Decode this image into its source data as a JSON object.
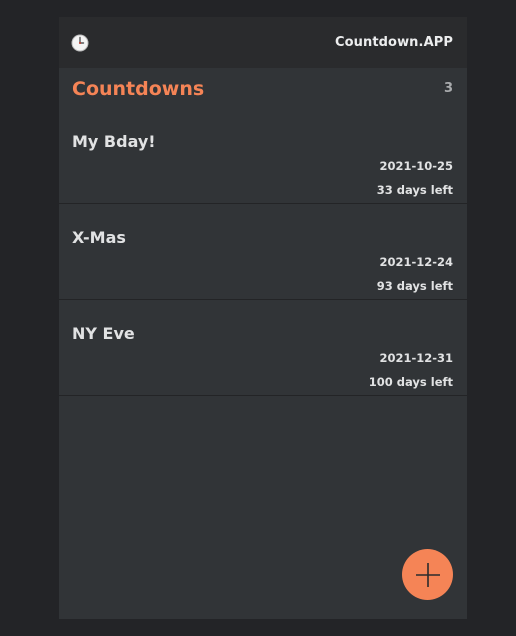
{
  "topbar": {
    "clock_icon": "clock-icon",
    "app_title": "Countdown.APP"
  },
  "header": {
    "title": "Countdowns",
    "count": "3"
  },
  "countdowns": [
    {
      "name": "My Bday!",
      "date": "2021-10-25",
      "days_left": "33 days left"
    },
    {
      "name": "X-Mas",
      "date": "2021-12-24",
      "days_left": "93 days left"
    },
    {
      "name": "NY Eve",
      "date": "2021-12-31",
      "days_left": "100 days left"
    }
  ],
  "fab": {
    "icon": "plus-icon"
  },
  "colors": {
    "accent": "#f58456",
    "background": "#232427",
    "panel": "#313437",
    "topbar": "#2a2b2d"
  }
}
